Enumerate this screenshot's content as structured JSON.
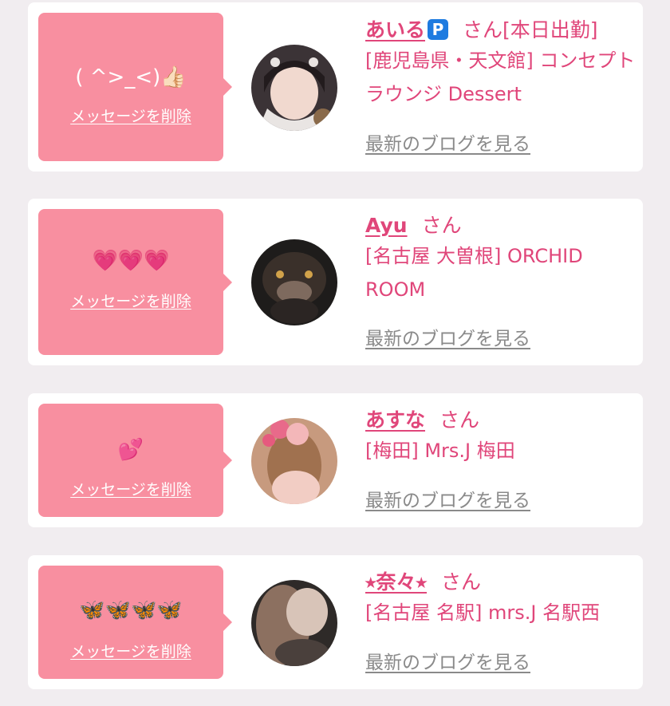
{
  "entries": [
    {
      "message": "( ^>_<)👍🏻",
      "delete_label": "メッセージを削除",
      "name": "あいる",
      "badge": "P",
      "honorific": "さん",
      "status": "[本日出勤]",
      "shop": "[鹿児島県・天文館] コンセプトラウンジ Dessert",
      "blog_label": "最新のブログを見る"
    },
    {
      "message": "💗💗💗",
      "delete_label": "メッセージを削除",
      "name": "Ayu",
      "honorific": "さん",
      "shop": "[名古屋 大曽根] ORCHID ROOM",
      "blog_label": "最新のブログを見る"
    },
    {
      "message": "💕",
      "delete_label": "メッセージを削除",
      "name": "あすな",
      "honorific": "さん",
      "shop": "[梅田] Mrs.J 梅田",
      "blog_label": "最新のブログを見る"
    },
    {
      "message": "🦋🦋🦋🦋",
      "delete_label": "メッセージを削除",
      "name": "⭑奈々⭑",
      "honorific": "さん",
      "shop": "[名古屋 名駅] mrs.J 名駅西",
      "blog_label": "最新のブログを見る"
    }
  ],
  "colors": {
    "background": "#f1edf0",
    "card": "#ffffff",
    "bubble": "#f88fa0",
    "accent": "#e0467a",
    "link_gray": "#8a8a8a"
  }
}
